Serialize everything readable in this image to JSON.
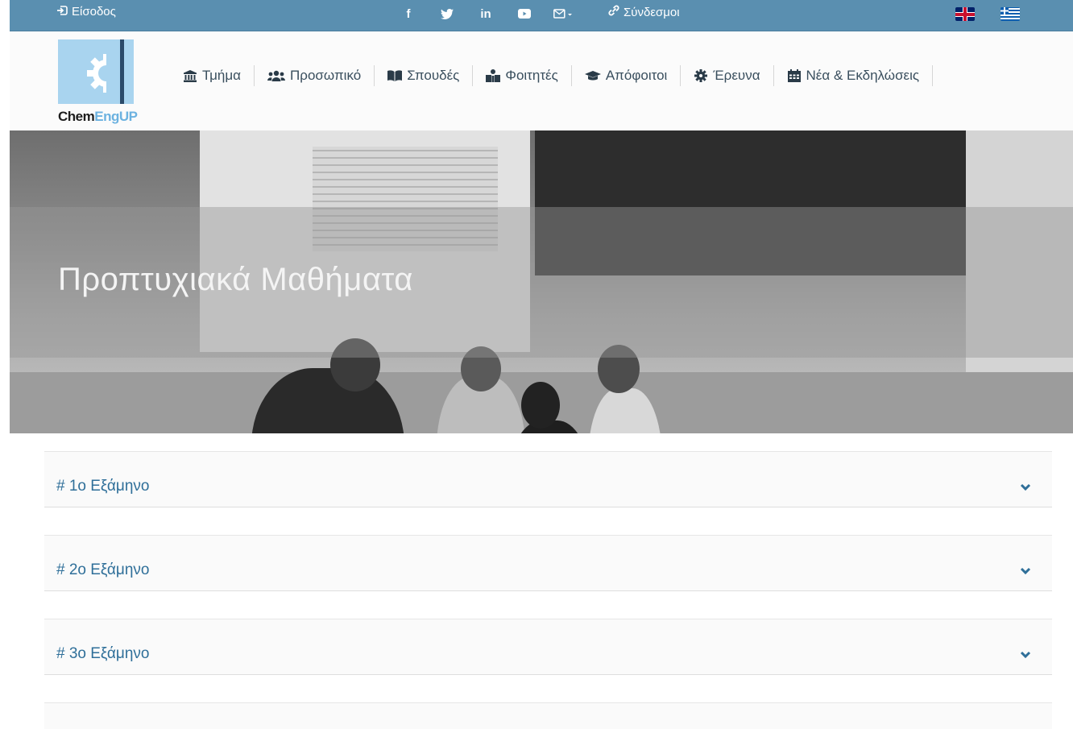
{
  "topbar": {
    "login_label": "Είσοδος",
    "social": [
      {
        "icon": "facebook-icon",
        "glyph": "f"
      },
      {
        "icon": "twitter-icon",
        "glyph": "🐦"
      },
      {
        "icon": "linkedin-icon",
        "glyph": "in"
      },
      {
        "icon": "youtube-icon",
        "glyph": "▶"
      },
      {
        "icon": "mail-icon",
        "glyph": "✉▾"
      }
    ],
    "links_label": "Σύνδεσμοι",
    "languages": [
      "en",
      "el"
    ]
  },
  "logo": {
    "text_dark": "Chem",
    "text_light": "EngUP"
  },
  "nav": {
    "items": [
      {
        "label": "Τμήμα",
        "icon": "university-icon"
      },
      {
        "label": "Προσωπικό",
        "icon": "users-icon"
      },
      {
        "label": "Σπουδές",
        "icon": "book-icon"
      },
      {
        "label": "Φοιτητές",
        "icon": "student-icon"
      },
      {
        "label": "Απόφοιτοι",
        "icon": "graduation-cap-icon"
      },
      {
        "label": "Έρευνα",
        "icon": "gear-icon"
      },
      {
        "label": "Νέα & Εκδηλώσεις",
        "icon": "calendar-icon"
      }
    ]
  },
  "hero": {
    "title": "Προπτυχιακά Μαθήματα"
  },
  "accordion": {
    "items": [
      {
        "label": "# 1ο Εξάμηνο"
      },
      {
        "label": "# 2ο Εξάμηνο"
      },
      {
        "label": "# 3ο Εξάμηνο"
      }
    ]
  },
  "colors": {
    "topbar": "#5a8fb0",
    "accent_text": "#2f6f99",
    "nav_text": "#3a4f5e"
  }
}
